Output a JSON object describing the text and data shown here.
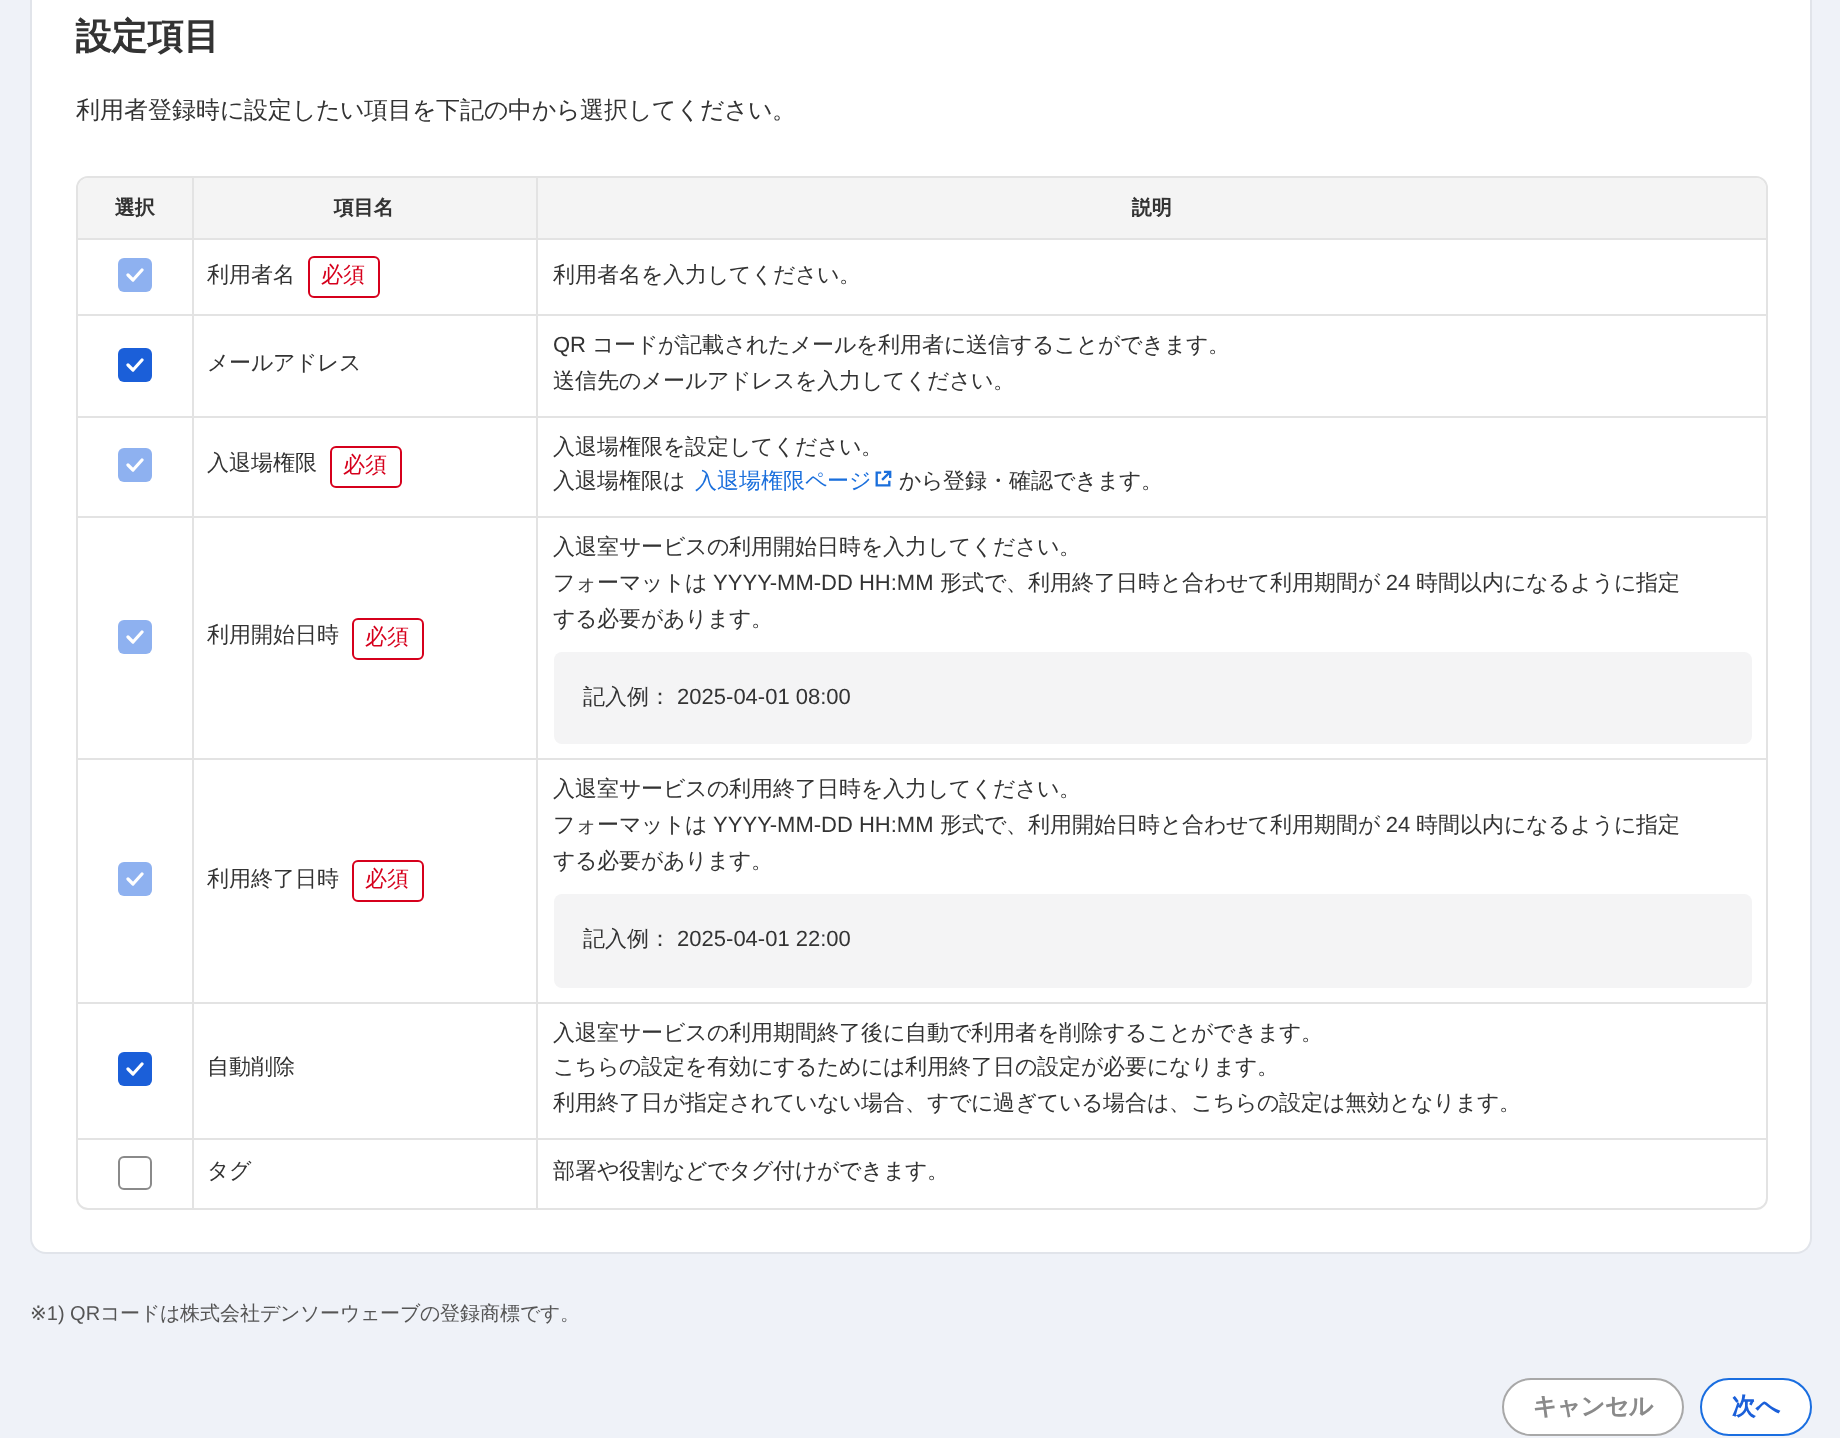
{
  "page": {
    "title": "設定項目",
    "description": "利用者登録時に設定したい項目を下記の中から選択してください。"
  },
  "table": {
    "columns": [
      "選択",
      "項目名",
      "説明"
    ],
    "rows": [
      {
        "checked": true,
        "disabled": true,
        "name": "利用者名",
        "badge": "必須",
        "description": [
          {
            "kind": "text",
            "text": "利用者名を入力してください。"
          }
        ]
      },
      {
        "checked": true,
        "disabled": false,
        "name": "メールアドレス",
        "description": [
          {
            "kind": "text",
            "text": "QR コードが記載されたメールを利用者に送信することができます。"
          },
          {
            "kind": "text",
            "text": "送信先のメールアドレスを入力してください。"
          }
        ]
      },
      {
        "checked": true,
        "disabled": true,
        "name": "入退場権限",
        "badge": "必須",
        "description": [
          {
            "kind": "text",
            "text": "入退場権限を設定してください。"
          },
          {
            "kind": "link_text",
            "before": "入退場権限は",
            "link": "入退場権限ページ",
            "after": "から登録・確認できます。"
          }
        ]
      },
      {
        "checked": true,
        "disabled": true,
        "name": "利用開始日時",
        "badge": "必須",
        "description": [
          {
            "kind": "text",
            "text": "入退室サービスの利用開始日時を入力してください。"
          },
          {
            "kind": "text",
            "text": "フォーマットは YYYY-MM-DD HH:MM 形式で、利用終了日時と合わせて利用期間が 24 時間以内になるように指定する必要があります。"
          },
          {
            "kind": "example",
            "text": "記入例： 2025-04-01 08:00"
          }
        ]
      },
      {
        "checked": true,
        "disabled": true,
        "name": "利用終了日時",
        "badge": "必須",
        "description": [
          {
            "kind": "text",
            "text": "入退室サービスの利用終了日時を入力してください。"
          },
          {
            "kind": "text",
            "text": "フォーマットは YYYY-MM-DD HH:MM 形式で、利用開始日時と合わせて利用期間が 24 時間以内になるように指定する必要があります。"
          },
          {
            "kind": "example",
            "text": "記入例： 2025-04-01 22:00"
          }
        ]
      },
      {
        "checked": true,
        "disabled": false,
        "name": "自動削除",
        "description": [
          {
            "kind": "text",
            "text": "入退室サービスの利用期間終了後に自動で利用者を削除することができます。"
          },
          {
            "kind": "text",
            "text": "こちらの設定を有効にするためには利用終了日の設定が必要になります。"
          },
          {
            "kind": "text",
            "text": "利用終了日が指定されていない場合、すでに過ぎている場合は、こちらの設定は無効となります。"
          }
        ]
      },
      {
        "checked": false,
        "disabled": false,
        "name": "タグ",
        "description": [
          {
            "kind": "text",
            "text": "部署や役割などでタグ付けができます。"
          }
        ]
      }
    ]
  },
  "footnote": "※1) QRコードは株式会社デンソーウェーブの登録商標です。",
  "buttons": [
    {
      "kind": "secondary",
      "label": "キャンセル"
    },
    {
      "kind": "primary",
      "label": "次へ"
    }
  ]
}
